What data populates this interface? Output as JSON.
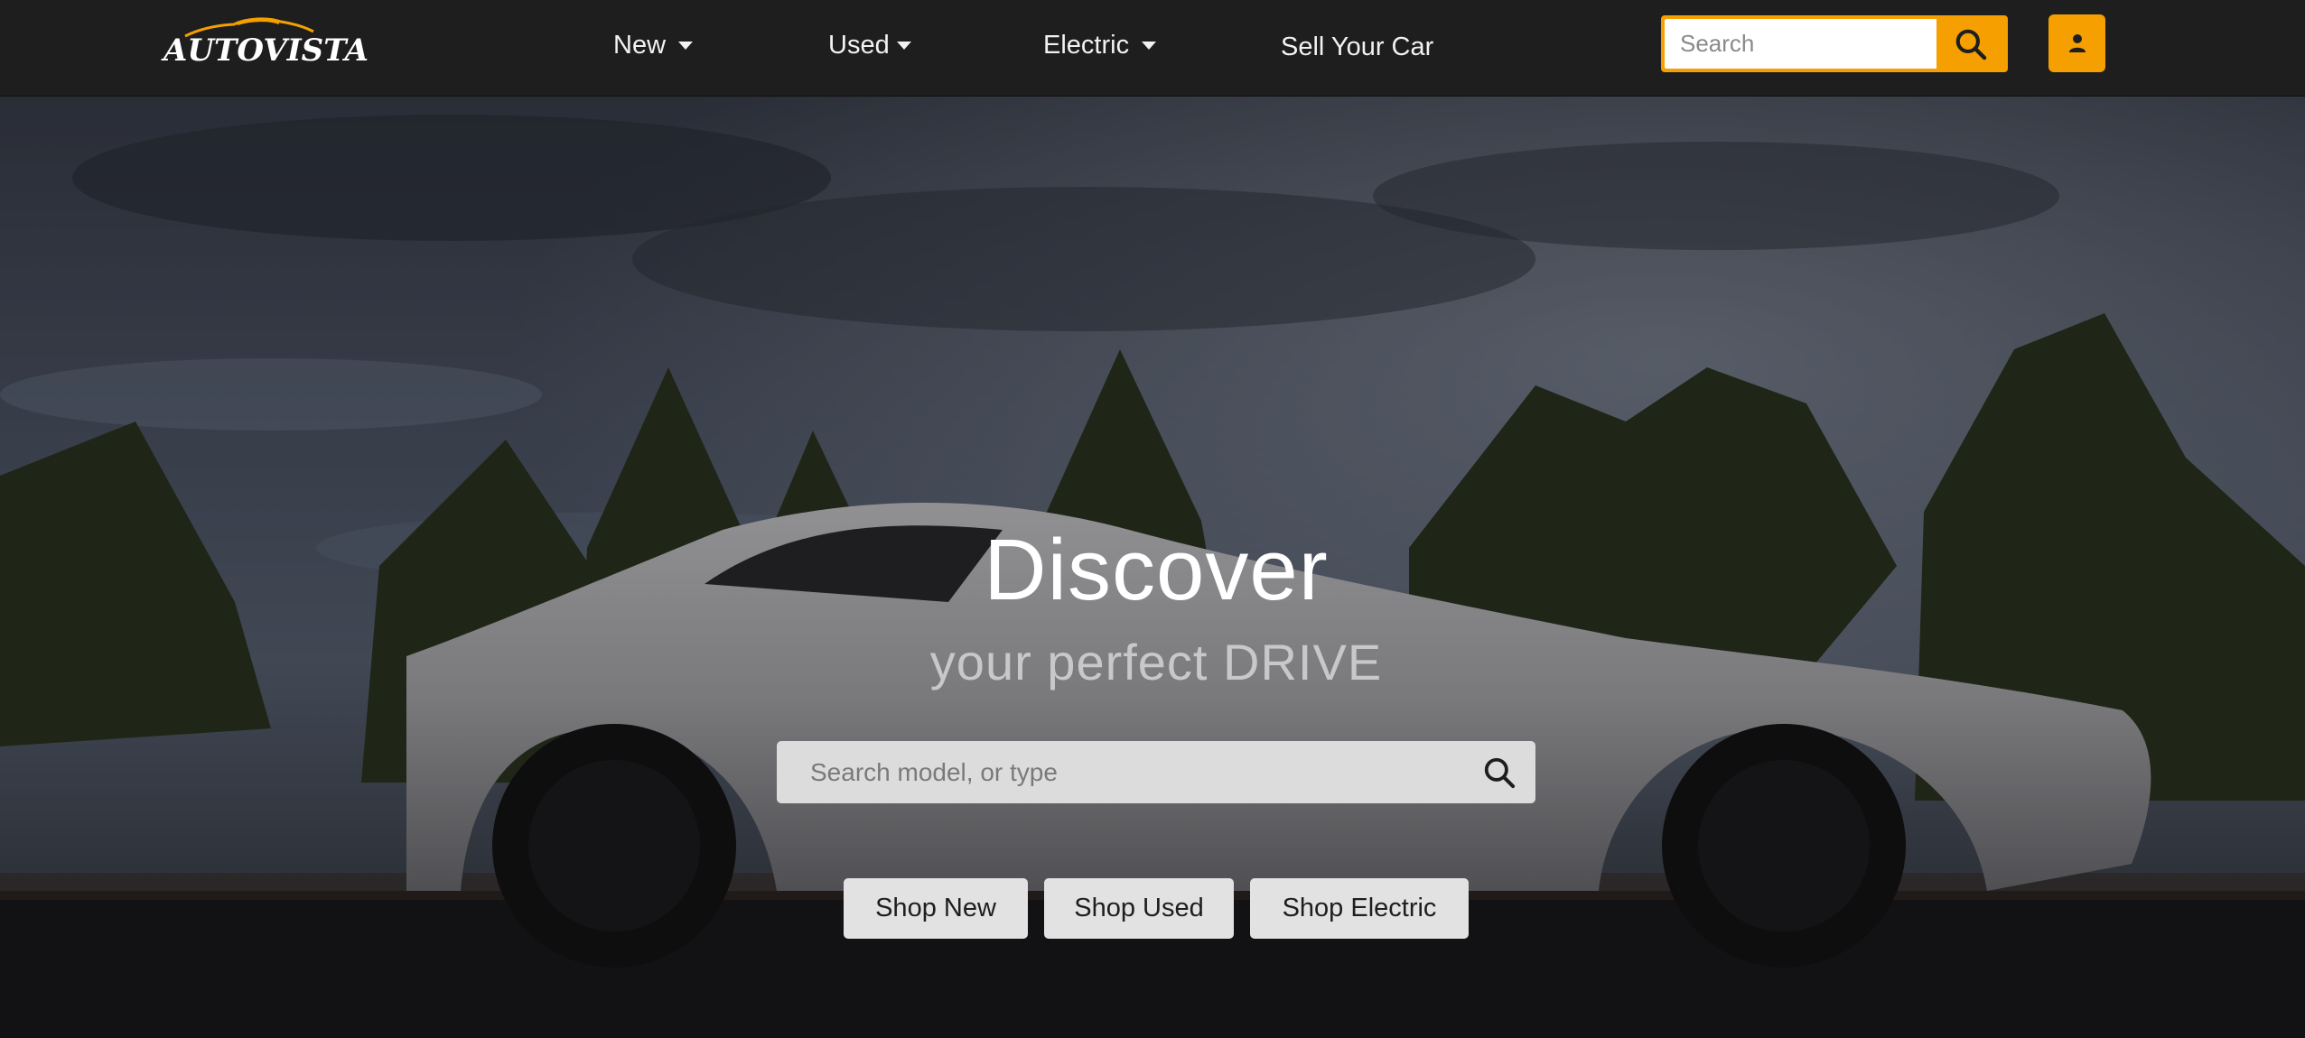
{
  "brand": {
    "name": "AUTOVISTA",
    "accent": "#f59f00"
  },
  "nav": {
    "items": [
      {
        "label": "New",
        "has_dropdown": true
      },
      {
        "label": "Used",
        "has_dropdown": true
      },
      {
        "label": "Electric",
        "has_dropdown": true
      },
      {
        "label": "Sell Your Car",
        "has_dropdown": false
      }
    ]
  },
  "header_search": {
    "placeholder": "Search",
    "icon": "search-icon"
  },
  "user_button": {
    "icon": "user-icon"
  },
  "hero": {
    "title": "Discover",
    "subtitle": "your perfect DRIVE",
    "search_placeholder": "Search model, or type",
    "search_icon": "search-icon",
    "buttons": [
      {
        "label": "Shop New"
      },
      {
        "label": "Shop Used"
      },
      {
        "label": "Shop Electric"
      }
    ]
  }
}
